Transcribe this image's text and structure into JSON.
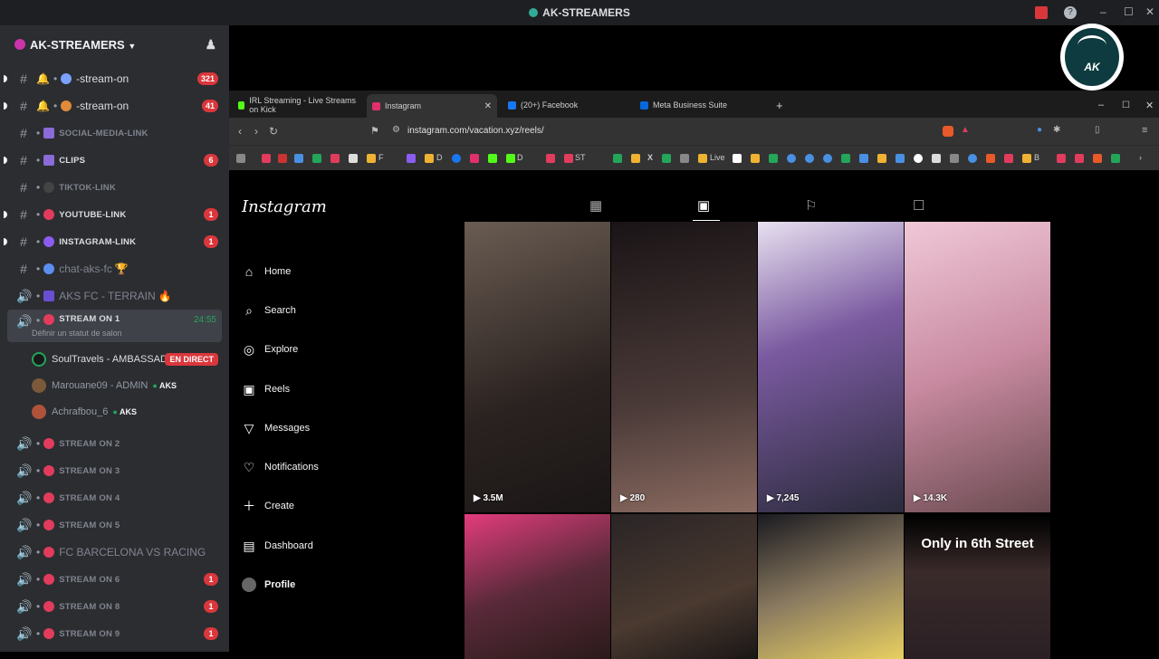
{
  "app": {
    "window_title": "AK-STREAMERS"
  },
  "server": {
    "name": "AK-STREAMERS",
    "chevron": "chevron-down-icon",
    "add_icon": "add-member-icon"
  },
  "channels": [
    {
      "name": "-stream-on",
      "badge": "321"
    },
    {
      "name": "-stream-on",
      "badge": "41"
    },
    {
      "name": "SOCIAL-MEDIA-LINK",
      "badge": ""
    },
    {
      "name": "CLIPS",
      "badge": "6"
    },
    {
      "name": "TIKTOK-LINK",
      "badge": ""
    },
    {
      "name": "YOUTUBE-LINK",
      "badge": "1"
    },
    {
      "name": "INSTAGRAM-LINK",
      "badge": "1"
    },
    {
      "name": "chat-aks-fc",
      "badge": ""
    },
    {
      "name": "AKS FC - TERRAIN",
      "badge": ""
    }
  ],
  "active_channel": {
    "name": "STREAM ON 1",
    "timer": "24:55",
    "status": "Définir un statut de salon"
  },
  "voice_users": [
    {
      "name": "SoulTravels - AMBASSADOR",
      "live": "EN DIRECT",
      "tag": ""
    },
    {
      "name": "Marouane09 - ADMIN",
      "live": "",
      "tag": "AKS"
    },
    {
      "name": "Achrafbou_6",
      "live": "",
      "tag": "AKS"
    }
  ],
  "voice_channels": [
    {
      "name": "STREAM ON 2",
      "badge": ""
    },
    {
      "name": "STREAM ON 3",
      "badge": ""
    },
    {
      "name": "STREAM ON 4",
      "badge": ""
    },
    {
      "name": "STREAM ON 5",
      "badge": ""
    },
    {
      "name": "FC BARCELONA VS RACING",
      "badge": ""
    },
    {
      "name": "STREAM ON 6",
      "badge": "1"
    },
    {
      "name": "STREAM ON 8",
      "badge": "1"
    },
    {
      "name": "STREAM ON 9",
      "badge": "1"
    }
  ],
  "browser": {
    "tabs": [
      {
        "label": "IRL Streaming - Live Streams on Kick",
        "color": "#53fc18"
      },
      {
        "label": "Instagram",
        "color": "#e1306c"
      },
      {
        "label": "(20+) Facebook",
        "color": "#1877f2"
      },
      {
        "label": "Meta Business Suite",
        "color": "#0668e1"
      }
    ],
    "url": "instagram.com/vacation.xyz/reels/",
    "bookmarks": [
      "F",
      "D",
      "D",
      "ST",
      "Live",
      "B"
    ]
  },
  "instagram": {
    "logo": "Instagram",
    "nav": [
      {
        "label": "Home",
        "icon": "home-icon"
      },
      {
        "label": "Search",
        "icon": "search-icon"
      },
      {
        "label": "Explore",
        "icon": "compass-icon"
      },
      {
        "label": "Reels",
        "icon": "reels-icon"
      },
      {
        "label": "Messages",
        "icon": "messages-icon"
      },
      {
        "label": "Notifications",
        "icon": "heart-icon"
      },
      {
        "label": "Create",
        "icon": "plus-icon"
      },
      {
        "label": "Dashboard",
        "icon": "dashboard-icon"
      },
      {
        "label": "Profile",
        "icon": "profile-avatar"
      }
    ],
    "reels": [
      {
        "count": "3.5M",
        "color": "#4a3d36"
      },
      {
        "count": "280",
        "color": "#3a2c2a"
      },
      {
        "count": "7,245",
        "color": "#6b5a70"
      },
      {
        "count": "14.3K",
        "color": "#c79ba8"
      },
      {
        "count": "",
        "color": "#7a3a55"
      },
      {
        "count": "",
        "color": "#1f1b1d"
      },
      {
        "count": "",
        "color": "#2a2426"
      },
      {
        "count": "",
        "color": "#333",
        "overlay": "Only in 6th Street"
      }
    ]
  }
}
